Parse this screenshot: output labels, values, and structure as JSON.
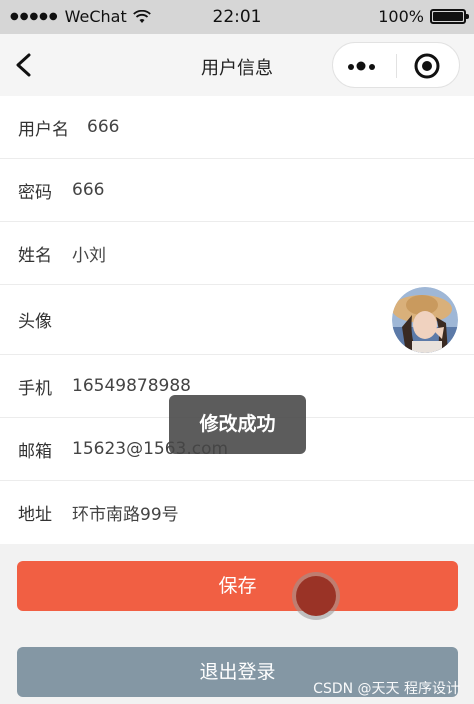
{
  "status_bar": {
    "signal_dots": "●●●●●",
    "carrier": "WeChat",
    "time": "22:01",
    "battery_text": "100%",
    "battery_level": 1.0
  },
  "nav": {
    "title": "用户信息",
    "back_icon": "chevron-left-icon",
    "more_icon": "more-dots-icon",
    "close_icon": "target-circle-icon"
  },
  "form": {
    "rows": [
      {
        "label": "用户名",
        "value": "666"
      },
      {
        "label": "密码",
        "value": "666"
      },
      {
        "label": "姓名",
        "value": "小刘"
      },
      {
        "label": "头像",
        "value": ""
      },
      {
        "label": "手机",
        "value": "16549878988"
      },
      {
        "label": "邮箱",
        "value": "15623@1563.com"
      },
      {
        "label": "地址",
        "value": "环市南路99号"
      }
    ]
  },
  "buttons": {
    "save": "保存",
    "logout": "退出登录"
  },
  "toast": "修改成功",
  "watermark": "CSDN @天天 程序设计",
  "colors": {
    "save": "#f15f43",
    "logout": "#8497a4",
    "toast_bg": "#464646"
  }
}
